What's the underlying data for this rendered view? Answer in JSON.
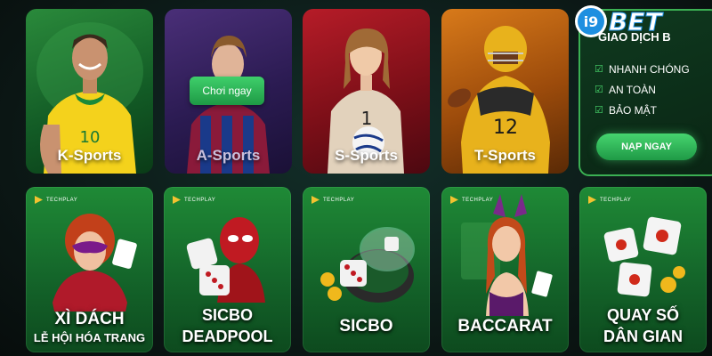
{
  "brand": {
    "logo_text": "i9BET"
  },
  "sports": [
    {
      "label": "K-Sports"
    },
    {
      "label": "A-Sports",
      "hover_button": "Chơi ngay"
    },
    {
      "label": "S-Sports"
    },
    {
      "label": "T-Sports"
    }
  ],
  "promo": {
    "title": "GIAO DỊCH B",
    "items": [
      "NHANH CHÓNG",
      "AN TOÀN",
      "BẢO MẬT"
    ],
    "button": "NẠP NGAY"
  },
  "games": [
    {
      "provider": "TECHPLAY",
      "title": "XÌ DÁCH",
      "subtitle": "LỄ HỘI HÓA TRANG"
    },
    {
      "provider": "TECHPLAY",
      "title_line1": "SICBO",
      "title_line2": "DEADPOOL"
    },
    {
      "provider": "TECHPLAY",
      "title": "SICBO"
    },
    {
      "provider": "TECHPLAY",
      "title": "BACCARAT"
    },
    {
      "provider": "TECHPLAY",
      "title_line1": "QUAY SỐ",
      "title_line2": "DÂN GIAN"
    }
  ],
  "colors": {
    "accent_green": "#3bb053",
    "button_green": "#1f9a46",
    "logo_blue": "#1e8fe0"
  }
}
